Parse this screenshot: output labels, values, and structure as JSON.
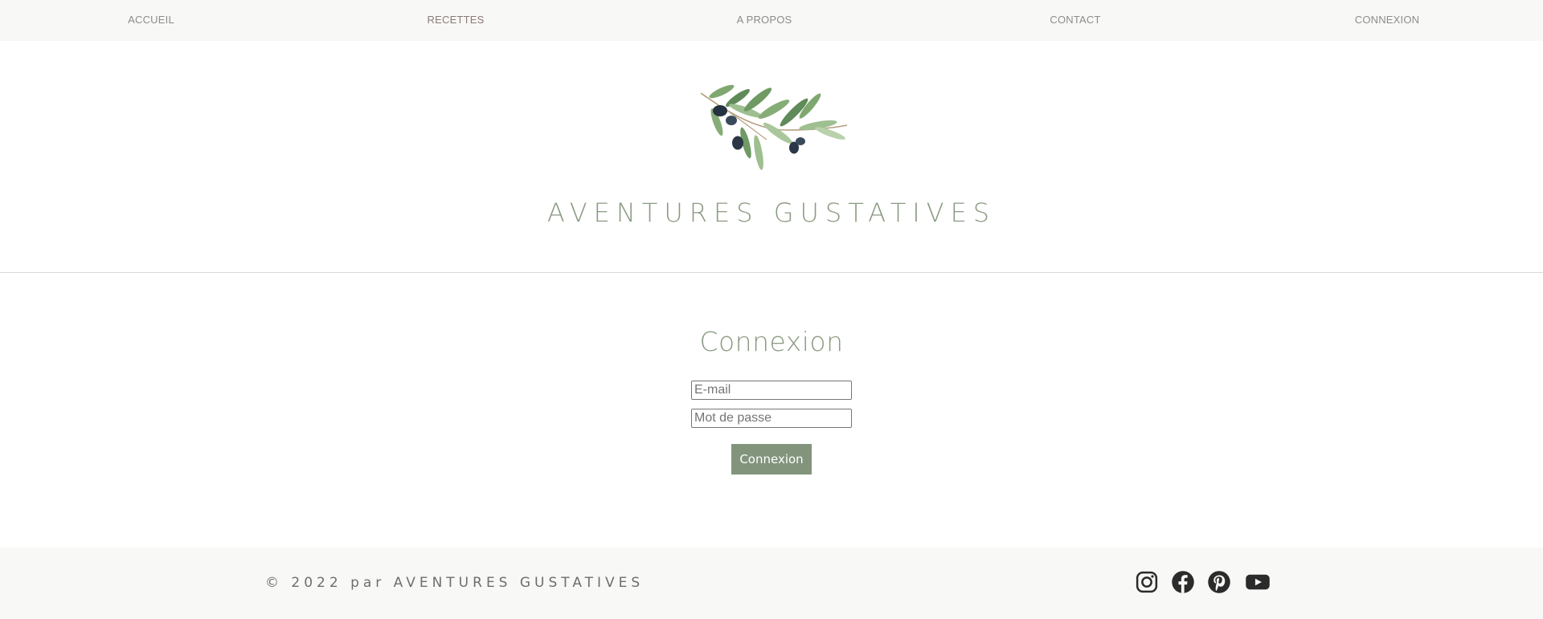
{
  "nav": {
    "items": [
      {
        "label": "ACCUEIL"
      },
      {
        "label": "RECETTES"
      },
      {
        "label": "A PROPOS"
      },
      {
        "label": "CONTACT"
      },
      {
        "label": "CONNEXION"
      }
    ],
    "active_index": 1
  },
  "header": {
    "brand": "AVENTURES GUSTATIVES",
    "logo_icon": "olive-branch-icon"
  },
  "login": {
    "title": "Connexion",
    "email_placeholder": "E-mail",
    "password_placeholder": "Mot de passe",
    "submit_label": "Connexion"
  },
  "footer": {
    "copyright": "© 2022 par AVENTURES GUSTATIVES",
    "social_icons": [
      "instagram-icon",
      "facebook-icon",
      "pinterest-icon",
      "youtube-icon"
    ]
  },
  "colors": {
    "accent": "#82947c",
    "brand_text": "#8a9a82",
    "nav_background": "#f8f8f6",
    "icon": "#2b2b2b"
  }
}
